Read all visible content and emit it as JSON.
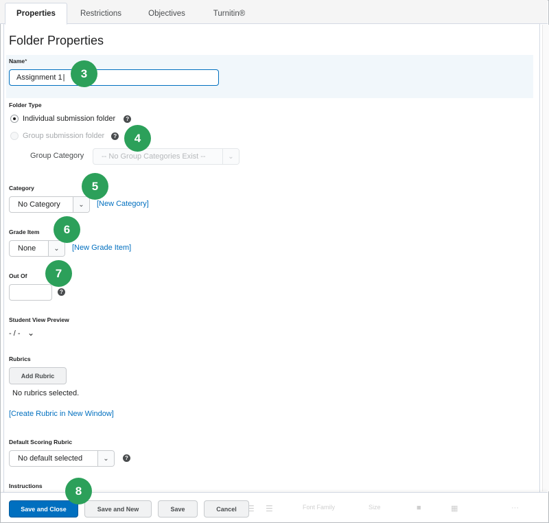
{
  "tabs": [
    {
      "label": "Properties",
      "active": true
    },
    {
      "label": "Restrictions",
      "active": false
    },
    {
      "label": "Objectives",
      "active": false
    },
    {
      "label": "Turnitin®",
      "active": false
    }
  ],
  "page_title": "Folder Properties",
  "name": {
    "label": "Name",
    "required_mark": "*",
    "value": "Assignment 1"
  },
  "folder_type": {
    "label": "Folder Type",
    "options": [
      {
        "label": "Individual submission folder",
        "checked": true,
        "disabled": false
      },
      {
        "label": "Group submission folder",
        "checked": false,
        "disabled": true
      }
    ],
    "group_category_label": "Group Category",
    "group_category_value": "-- No Group Categories Exist --"
  },
  "category": {
    "label": "Category",
    "value": "No Category",
    "new_link": "[New Category]"
  },
  "grade_item": {
    "label": "Grade Item",
    "value": "None",
    "new_link": "[New Grade Item]"
  },
  "out_of": {
    "label": "Out Of",
    "value": ""
  },
  "student_view": {
    "label": "Student View Preview",
    "value": "- / -"
  },
  "rubrics": {
    "label": "Rubrics",
    "add_button": "Add Rubric",
    "empty_text": "No rubrics selected.",
    "create_link": "[Create Rubric in New Window]"
  },
  "default_scoring": {
    "label": "Default Scoring Rubric",
    "value": "No default selected"
  },
  "instructions": {
    "label": "Instructions"
  },
  "editor_toolbar": {
    "font_family": "Font Family",
    "size": "Size",
    "more": "···"
  },
  "footer": {
    "save_close": "Save and Close",
    "save_new": "Save and New",
    "save": "Save",
    "cancel": "Cancel"
  },
  "badges": [
    "3",
    "4",
    "5",
    "6",
    "7",
    "8"
  ],
  "icons": {
    "help": "?",
    "chevron": "⌄"
  },
  "colors": {
    "accent": "#006fbf",
    "badge": "#2ca05a",
    "panel": "#f1f7fb"
  }
}
